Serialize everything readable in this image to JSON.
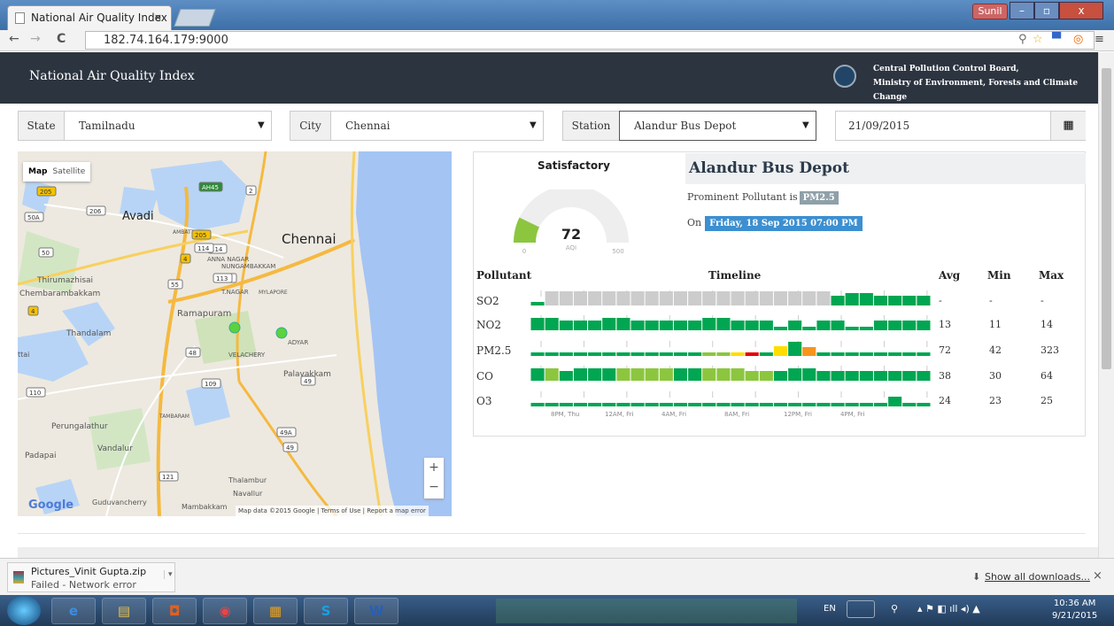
{
  "browser": {
    "tab_title": "National Air Quality Index",
    "tab_close": "×",
    "url": "182.74.164.179:9000",
    "user": "Sunil",
    "win_min": "–",
    "win_max": "▫",
    "win_close": "x"
  },
  "header": {
    "title": "National Air Quality Index",
    "org_line1": "Central Pollution Control Board,",
    "org_line2": "Ministry of Environment, Forests and Climate Change"
  },
  "filters": {
    "state_label": "State",
    "state_value": "Tamilnadu",
    "city_label": "City",
    "city_value": "Chennai",
    "station_label": "Station",
    "station_value": "Alandur Bus Depot",
    "date_value": "21/09/2015"
  },
  "map": {
    "tab_map": "Map",
    "tab_satellite": "Satellite",
    "zoom_in": "+",
    "zoom_out": "−",
    "google": "Google",
    "attribution": "Map data ©2015 Google",
    "terms": "Terms of Use",
    "report": "Report a map error",
    "labels": [
      "Avadi",
      "Chennai",
      "AMBATTUR",
      "ANNA NAGAR",
      "NUNGAMBAKKAM",
      "Thirumazhisai",
      "Chembarambakkam",
      "T.NAGAR",
      "MYLAPORE",
      "Ramapuram",
      "Thandalam",
      "ADYAR",
      "VELACHERY",
      "Palavakkam",
      "TAMBARAM",
      "Perungalathur",
      "Vandalur",
      "Padapai",
      "Thalambur",
      "Navallur",
      "Guduvancherry",
      "Mambakkam",
      "ttai"
    ],
    "shields": [
      "205",
      "114",
      "206",
      "50A",
      "2",
      "205",
      "114",
      "50",
      "4",
      "55",
      "113",
      "4",
      "113",
      "48",
      "109",
      "49",
      "110",
      "49A",
      "49",
      "121",
      "AH45"
    ]
  },
  "panel": {
    "category": "Satisfactory",
    "aqi": "72",
    "aqi_label": "AQI",
    "gauge_min": "0",
    "gauge_max": "500",
    "station_name": "Alandur Bus Depot",
    "prominent_text": "Prominent Pollutant is",
    "prominent_value": "PM2.5",
    "on_text": "On",
    "on_value": "Friday, 18 Sep 2015 07:00 PM",
    "col_pollutant": "Pollutant",
    "col_timeline": "Timeline",
    "col_avg": "Avg",
    "col_min": "Min",
    "col_max": "Max",
    "time_labels": [
      "8PM, Thu",
      "12AM, Fri",
      "4AM, Fri",
      "8AM, Fri",
      "12PM, Fri",
      "4PM, Fri"
    ]
  },
  "pollutants": [
    {
      "name": "SO2",
      "avg": "-",
      "min": "-",
      "max": "-",
      "color_codes": "1000000000000000000002222222"
    },
    {
      "name": "NO2",
      "avg": "13",
      "min": "11",
      "max": "14",
      "color_codes": "2222222222222222222222222222"
    },
    {
      "name": "PM2.5",
      "avg": "72",
      "min": "42",
      "max": "323",
      "color_codes": "2222222222223345222222222222"
    },
    {
      "name": "CO",
      "avg": "38",
      "min": "30",
      "max": "64",
      "color_codes": "2322223333223333322222222222"
    },
    {
      "name": "O3",
      "avg": "24",
      "min": "23",
      "max": "25",
      "color_codes": "2222222222222222222222222222"
    }
  ],
  "pollutant_levels": [
    [
      1,
      0,
      0,
      0,
      0,
      0,
      0,
      0,
      0,
      0,
      0,
      0,
      0,
      0,
      0,
      0,
      0,
      0,
      0,
      0,
      0,
      2,
      3,
      3,
      2,
      2,
      2,
      2
    ],
    [
      3,
      3,
      2,
      2,
      2,
      3,
      3,
      2,
      2,
      2,
      2,
      2,
      3,
      3,
      2,
      2,
      2,
      1,
      2,
      1,
      2,
      2,
      1,
      1,
      2,
      2,
      2,
      2
    ],
    [
      1,
      1,
      1,
      1,
      1,
      1,
      1,
      1,
      1,
      1,
      1,
      1,
      1,
      1,
      1,
      1,
      1,
      2,
      3,
      2,
      1,
      1,
      1,
      1,
      1,
      1,
      1,
      1
    ],
    [
      3,
      3,
      2,
      3,
      3,
      3,
      3,
      3,
      3,
      3,
      3,
      3,
      3,
      3,
      3,
      2,
      2,
      2,
      3,
      3,
      2,
      2,
      2,
      2,
      2,
      2,
      2,
      2
    ],
    [
      1,
      1,
      1,
      1,
      1,
      1,
      1,
      1,
      1,
      1,
      1,
      1,
      1,
      1,
      1,
      1,
      1,
      1,
      1,
      1,
      1,
      1,
      1,
      1,
      1,
      2,
      1,
      1
    ]
  ],
  "colors": {
    "good": "#00a651",
    "satisfactory": "#8cc63f",
    "moderate": "#ffdd00",
    "poor": "#f7941d",
    "very_poor": "#e60000",
    "nodata": "#cccccc",
    "header_bg": "#2c3440",
    "badge_blue": "#3c8fd0"
  },
  "downloads": {
    "file": "Pictures_Vinit Gupta.zip",
    "status": "Failed - Network error",
    "show_all": "Show all downloads...",
    "close": "×"
  },
  "taskbar": {
    "lang": "EN",
    "time": "10:36 AM",
    "date": "9/21/2015",
    "apps": [
      "e",
      "▤",
      "◘",
      "◉",
      "▦",
      "S",
      "W"
    ]
  }
}
